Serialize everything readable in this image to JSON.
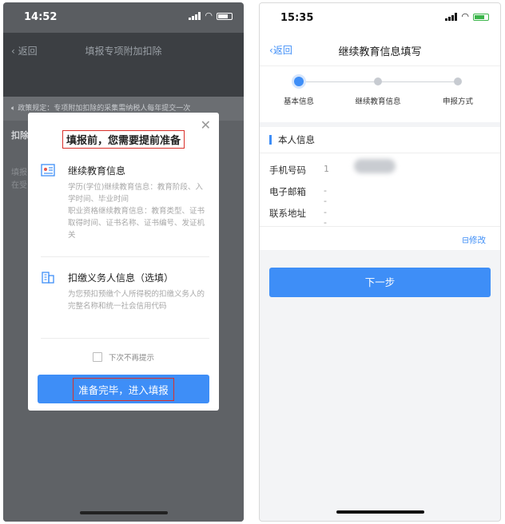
{
  "left": {
    "status": {
      "time": "14:52"
    },
    "background": {
      "back_label": "返回",
      "title": "填报专项附加扣除",
      "notice": "政策规定：专项附加扣除的采集需纳税人每年提交一次",
      "row1": "扣除",
      "row2": "填报",
      "row3": "在受"
    },
    "modal": {
      "close_glyph": "✕",
      "heading": "填报前，您需要提前准备",
      "sections": [
        {
          "title": "继续教育信息",
          "desc": "学历(学位)继续教育信息：教育阶段、入学时间、毕业时间\n职业资格继续教育信息：教育类型、证书取得时间、证书名称、证书编号、发证机关"
        },
        {
          "title": "扣缴义务人信息（选填）",
          "desc": "为您预扣预缴个人所得税的扣缴义务人的完整名称和统一社会信用代码"
        }
      ],
      "checkbox_label": "下次不再提示",
      "primary_button": "准备完毕，进入填报"
    }
  },
  "right": {
    "status": {
      "time": "15:35"
    },
    "nav": {
      "back_label": "返回",
      "title": "继续教育信息填写"
    },
    "steps": [
      {
        "label": "基本信息",
        "active": true
      },
      {
        "label": "继续教育信息",
        "active": false
      },
      {
        "label": "申报方式",
        "active": false
      }
    ],
    "info": {
      "section_title": "本人信息",
      "fields": [
        {
          "label": "手机号码",
          "value": "1"
        },
        {
          "label": "电子邮箱",
          "value": "--"
        },
        {
          "label": "联系地址",
          "value": "--"
        }
      ],
      "edit_label": "修改"
    },
    "next_button": "下一步"
  },
  "colors": {
    "accent": "#3e8ef7",
    "highlight_border": "#d9302a"
  }
}
